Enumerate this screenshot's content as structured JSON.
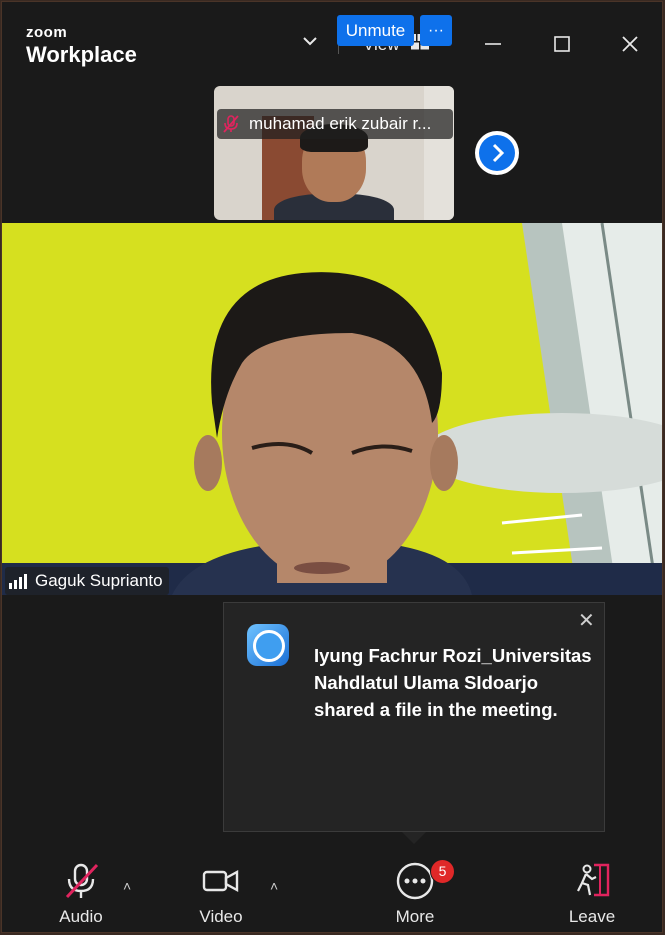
{
  "app": {
    "brand_top": "zoom",
    "brand_bottom": "Workplace"
  },
  "titlebar": {
    "view_label": "View",
    "icons": [
      "chevron-down-icon",
      "grid-icon",
      "minimize-icon",
      "maximize-icon",
      "close-icon"
    ]
  },
  "thumbnail": {
    "participant_name": "muhamad erik zubair r...",
    "unmute_label": "Unmute",
    "more_label": "···",
    "muted": true
  },
  "main_video": {
    "speaker_name": "Gaguk Suprianto"
  },
  "notification": {
    "message": "Iyung Fachrur Rozi_Universitas Nahdlatul Ulama SIdoarjo shared a file in the meeting.",
    "close_symbol": "✕"
  },
  "toolbar": {
    "audio_label": "Audio",
    "video_label": "Video",
    "more_label": "More",
    "more_badge": "5",
    "leave_label": "Leave",
    "caret_symbol": "˄"
  },
  "colors": {
    "accent": "#0e71eb",
    "badge": "#e02828",
    "muted_red": "#e0245e"
  }
}
